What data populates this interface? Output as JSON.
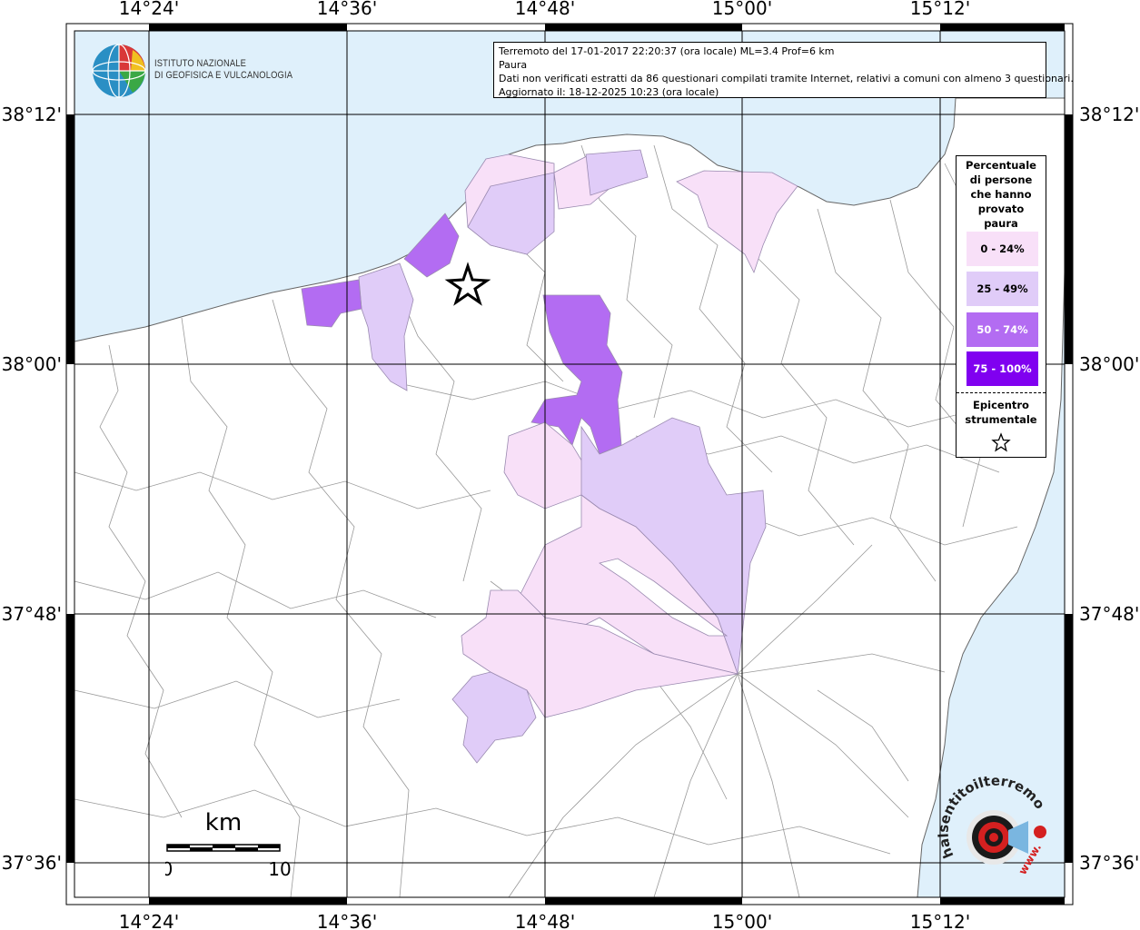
{
  "info_box": {
    "line1": "Terremoto del 17-01-2017 22:20:37 (ora locale) ML=3.4 Prof=6 km",
    "line2": "Paura",
    "line3": "Dati non verificati estratti da 86 questionari compilati tramite Internet, relativi a comuni con almeno 3 questionari.",
    "line4": "Aggiornato il: 18-12-2025 10:23 (ora locale)"
  },
  "logo": {
    "line1": "ISTITUTO NAZIONALE",
    "line2": "DI GEOFISICA E VULCANOLOGIA"
  },
  "axes": {
    "top": [
      "14°24'",
      "14°36'",
      "14°48'",
      "15°00'",
      "15°12'"
    ],
    "bottom": [
      "14°24'",
      "14°36'",
      "14°48'",
      "15°00'",
      "15°12'"
    ],
    "left": [
      "38°12'",
      "38°00'",
      "37°48'",
      "37°36'"
    ],
    "right": [
      "38°12'",
      "38°00'",
      "37°48'",
      "37°36'"
    ]
  },
  "legend": {
    "title": "Percentuale di persone che hanno provato paura",
    "title_lines": [
      "Percentuale",
      "di persone",
      "che hanno",
      "provato",
      "paura"
    ],
    "classes": [
      {
        "label": "0 - 24%",
        "color": "#f8e0f8"
      },
      {
        "label": "25 - 49%",
        "color": "#e0ccf8"
      },
      {
        "label": "50 - 74%",
        "color": "#b36cf2"
      },
      {
        "label": "75 - 100%",
        "color": "#8000f0"
      }
    ],
    "epicenter_lines": [
      "Epicentro",
      "strumentale"
    ]
  },
  "scale_bar": {
    "unit": "km",
    "start": "0",
    "end": "10"
  },
  "watermark": {
    "text": "haisentitoilterremoto.it",
    "url_text": "www."
  },
  "colors": {
    "sea": "#dff0fb",
    "land": "#ffffff",
    "grid": "#000000",
    "boundary": "#999999"
  }
}
